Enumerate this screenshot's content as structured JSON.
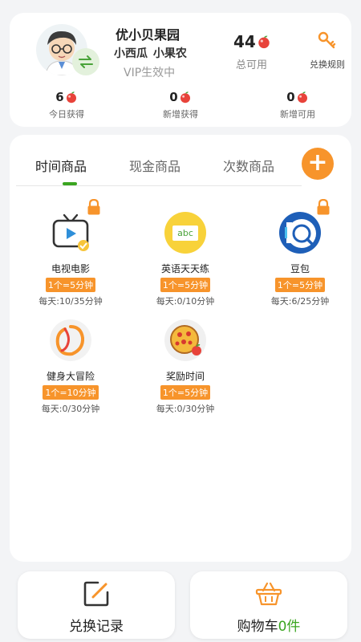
{
  "profile": {
    "park_name": "优小贝果园",
    "user_names": "小西瓜 小果农",
    "vip_status": "VIP生效中",
    "total_count": "44",
    "total_label": "总可用",
    "rules_label": "兑换规则",
    "stats": [
      {
        "value": "6",
        "label": "今日获得"
      },
      {
        "value": "0",
        "label": "新增获得"
      },
      {
        "value": "0",
        "label": "新增可用"
      }
    ]
  },
  "tabs": [
    {
      "label": "时间商品",
      "active": true
    },
    {
      "label": "现金商品",
      "active": false
    },
    {
      "label": "次数商品",
      "active": false
    }
  ],
  "add_symbol": "+",
  "items": [
    {
      "name": "电视电影",
      "rate": "1个=5分钟",
      "daily": "每天:10/35分钟",
      "icon": "tv-icon",
      "locked": true
    },
    {
      "name": "英语天天练",
      "rate": "1个=5分钟",
      "daily": "每天:0/10分钟",
      "icon": "abc-icon",
      "locked": false
    },
    {
      "name": "豆包",
      "rate": "1个=5分钟",
      "daily": "每天:6/25分钟",
      "icon": "doubao-icon",
      "locked": true
    },
    {
      "name": "健身大冒险",
      "rate": "1个=10分钟",
      "daily": "每天:0/30分钟",
      "icon": "fitness-ring-icon",
      "locked": false
    },
    {
      "name": "奖励时间",
      "rate": "1个=5分钟",
      "daily": "每天:0/30分钟",
      "icon": "pizza-icon",
      "locked": false
    }
  ],
  "bottom": {
    "history_label": "兑换记录",
    "cart_label": "购物车",
    "cart_count": "0件"
  },
  "colors": {
    "accent_orange": "#f7942b",
    "accent_green": "#3aa520",
    "apple_red": "#e8433a"
  }
}
